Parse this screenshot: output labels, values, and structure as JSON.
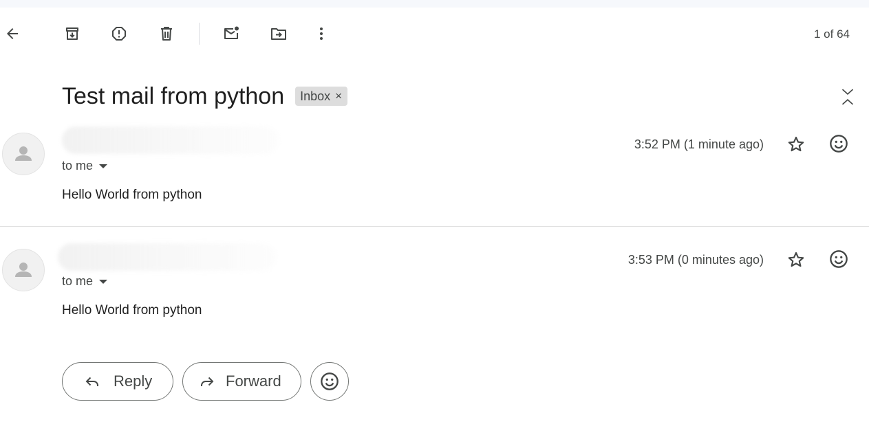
{
  "toolbar": {
    "icons": [
      "back-arrow-icon",
      "archive-icon",
      "report-spam-icon",
      "delete-icon",
      "mark-unread-icon",
      "move-to-icon",
      "more-vert-icon"
    ],
    "pager": "1 of 64"
  },
  "thread": {
    "subject": "Test mail from python",
    "label": "Inbox",
    "label_remove": "×"
  },
  "messages": [
    {
      "recipient": "to me",
      "time": "3:52 PM (1 minute ago)",
      "body": "Hello World from python"
    },
    {
      "recipient": "to me",
      "time": "3:53 PM (0 minutes ago)",
      "body": "Hello World from python"
    }
  ],
  "actions": {
    "reply": "Reply",
    "forward": "Forward"
  },
  "colors": {
    "text": "#1f1f1f",
    "secondary": "#444746",
    "chip_bg": "#dddddd",
    "divider": "#e0e0e0"
  }
}
